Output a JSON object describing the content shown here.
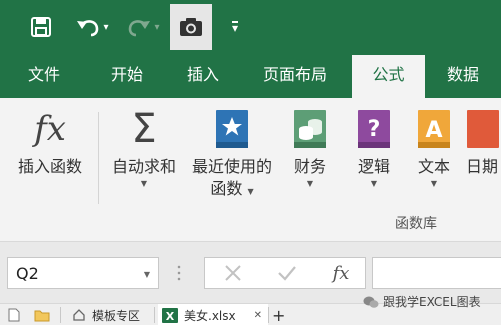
{
  "qat": {
    "more_symbol": "▾",
    "undo_caret": "▾",
    "redo_caret": "▾"
  },
  "tabs": [
    {
      "label": "文件",
      "active": false
    },
    {
      "label": "开始",
      "active": false
    },
    {
      "label": "插入",
      "active": false
    },
    {
      "label": "页面布局",
      "active": false
    },
    {
      "label": "公式",
      "active": true
    },
    {
      "label": "数据",
      "active": false
    }
  ],
  "ribbon": {
    "insert_function": {
      "label": "插入函数",
      "icon": "fx-icon"
    },
    "autosum": {
      "label": "自动求和",
      "icon": "sigma-icon"
    },
    "recent": {
      "label_line1": "最近使用的",
      "label_line2": "函数",
      "icon": "star-book-icon"
    },
    "financial": {
      "label": "财务",
      "icon": "coins-book-icon"
    },
    "logical": {
      "label": "逻辑",
      "icon": "question-book-icon"
    },
    "text": {
      "label": "文本",
      "icon": "letter-a-book-icon"
    },
    "datetime": {
      "label": "日期"
    },
    "group_label": "函数库",
    "colors": {
      "blue_book": "#2e74b5",
      "green_book": "#5d9e76",
      "purple_book": "#8e4a9e",
      "orange_book": "#f0a73a"
    }
  },
  "formula_bar": {
    "name_box": "Q2",
    "fx": "fx"
  },
  "file_tabs": [
    {
      "label": "模板专区",
      "active": false
    },
    {
      "label": "美女.xlsx",
      "active": true
    }
  ],
  "file_tab_close": "✕",
  "file_tab_add": "+",
  "watermark": "跟我学EXCEL图表",
  "theme": {
    "ribbon_green": "#217346"
  }
}
